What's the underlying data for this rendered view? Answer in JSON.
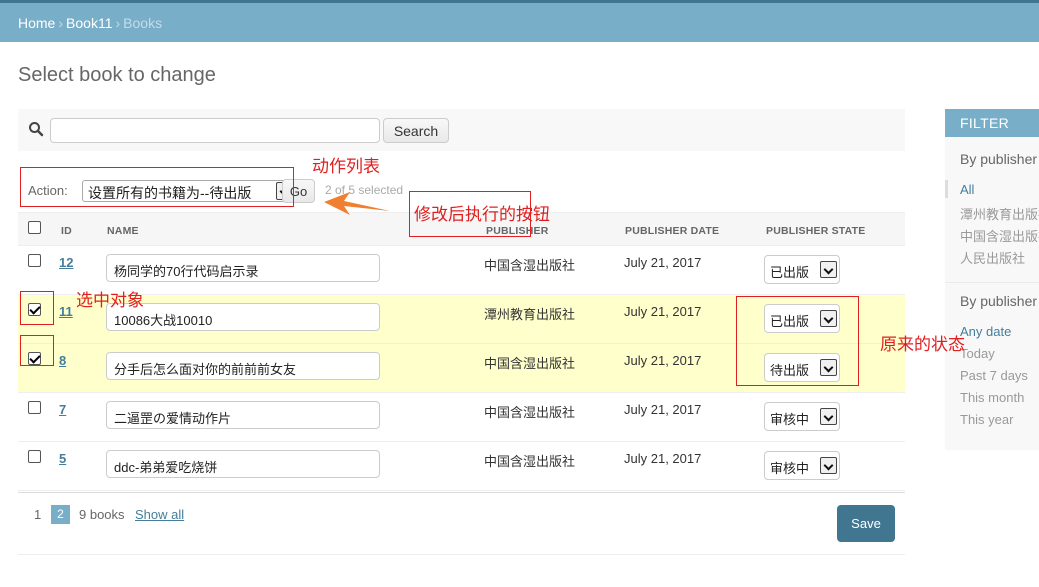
{
  "breadcrumbs": {
    "home": "Home",
    "app": "Book11",
    "current": "Books",
    "sep": "›"
  },
  "page_title": "Select book to change",
  "search": {
    "value": "",
    "placeholder": "",
    "button": "Search"
  },
  "actions": {
    "label": "Action:",
    "selected_option": "设置所有的书籍为--待出版",
    "go_button": "Go",
    "selected_count": "2 of 5 selected"
  },
  "columns": {
    "id": "ID",
    "name": "NAME",
    "publisher": "PUBLISHER",
    "publisher_date": "PUBLISHER DATE",
    "publisher_state": "PUBLISHER STATE"
  },
  "rows": [
    {
      "id": "12",
      "name": "杨同学的70行代码启示录",
      "publisher": "中国含湿出版社",
      "date": "July 21, 2017",
      "state": "已出版",
      "selected": false
    },
    {
      "id": "11",
      "name": "10086大战10010",
      "publisher": "潭州教育出版社",
      "date": "July 21, 2017",
      "state": "已出版",
      "selected": true
    },
    {
      "id": "8",
      "name": "分手后怎么面对你的前前前女友",
      "publisher": "中国含湿出版社",
      "date": "July 21, 2017",
      "state": "待出版",
      "selected": true
    },
    {
      "id": "7",
      "name": "二逼罡の爱情动作片",
      "publisher": "中国含湿出版社",
      "date": "July 21, 2017",
      "state": "审核中",
      "selected": false
    },
    {
      "id": "5",
      "name": "ddc-弟弟爱吃烧饼",
      "publisher": "中国含湿出版社",
      "date": "July 21, 2017",
      "state": "审核中",
      "selected": false
    }
  ],
  "paginator": {
    "page1": "1",
    "page2": "2",
    "count": "9 books",
    "show_all": "Show all"
  },
  "save_button": "Save",
  "filter": {
    "title": "FILTER",
    "group1_title": "By publisher",
    "group1_items": [
      "All",
      "潭州教育出版社",
      "中国含湿出版社",
      "人民出版社"
    ],
    "group2_title": "By publisher",
    "group2_items": [
      "Any date",
      "Today",
      "Past 7 days",
      "This month",
      "This year"
    ]
  },
  "annotations": {
    "action_list": "动作列表",
    "go_hint": "修改后执行的按钮",
    "select_hint": "选中对象",
    "state_hint": "原来的状态"
  },
  "colors": {
    "header": "#79aec8",
    "header_border": "#417690",
    "link": "#447e9b",
    "selected_row": "#ffffcc",
    "annotation": "#e02020",
    "arrow": "#f08030"
  }
}
